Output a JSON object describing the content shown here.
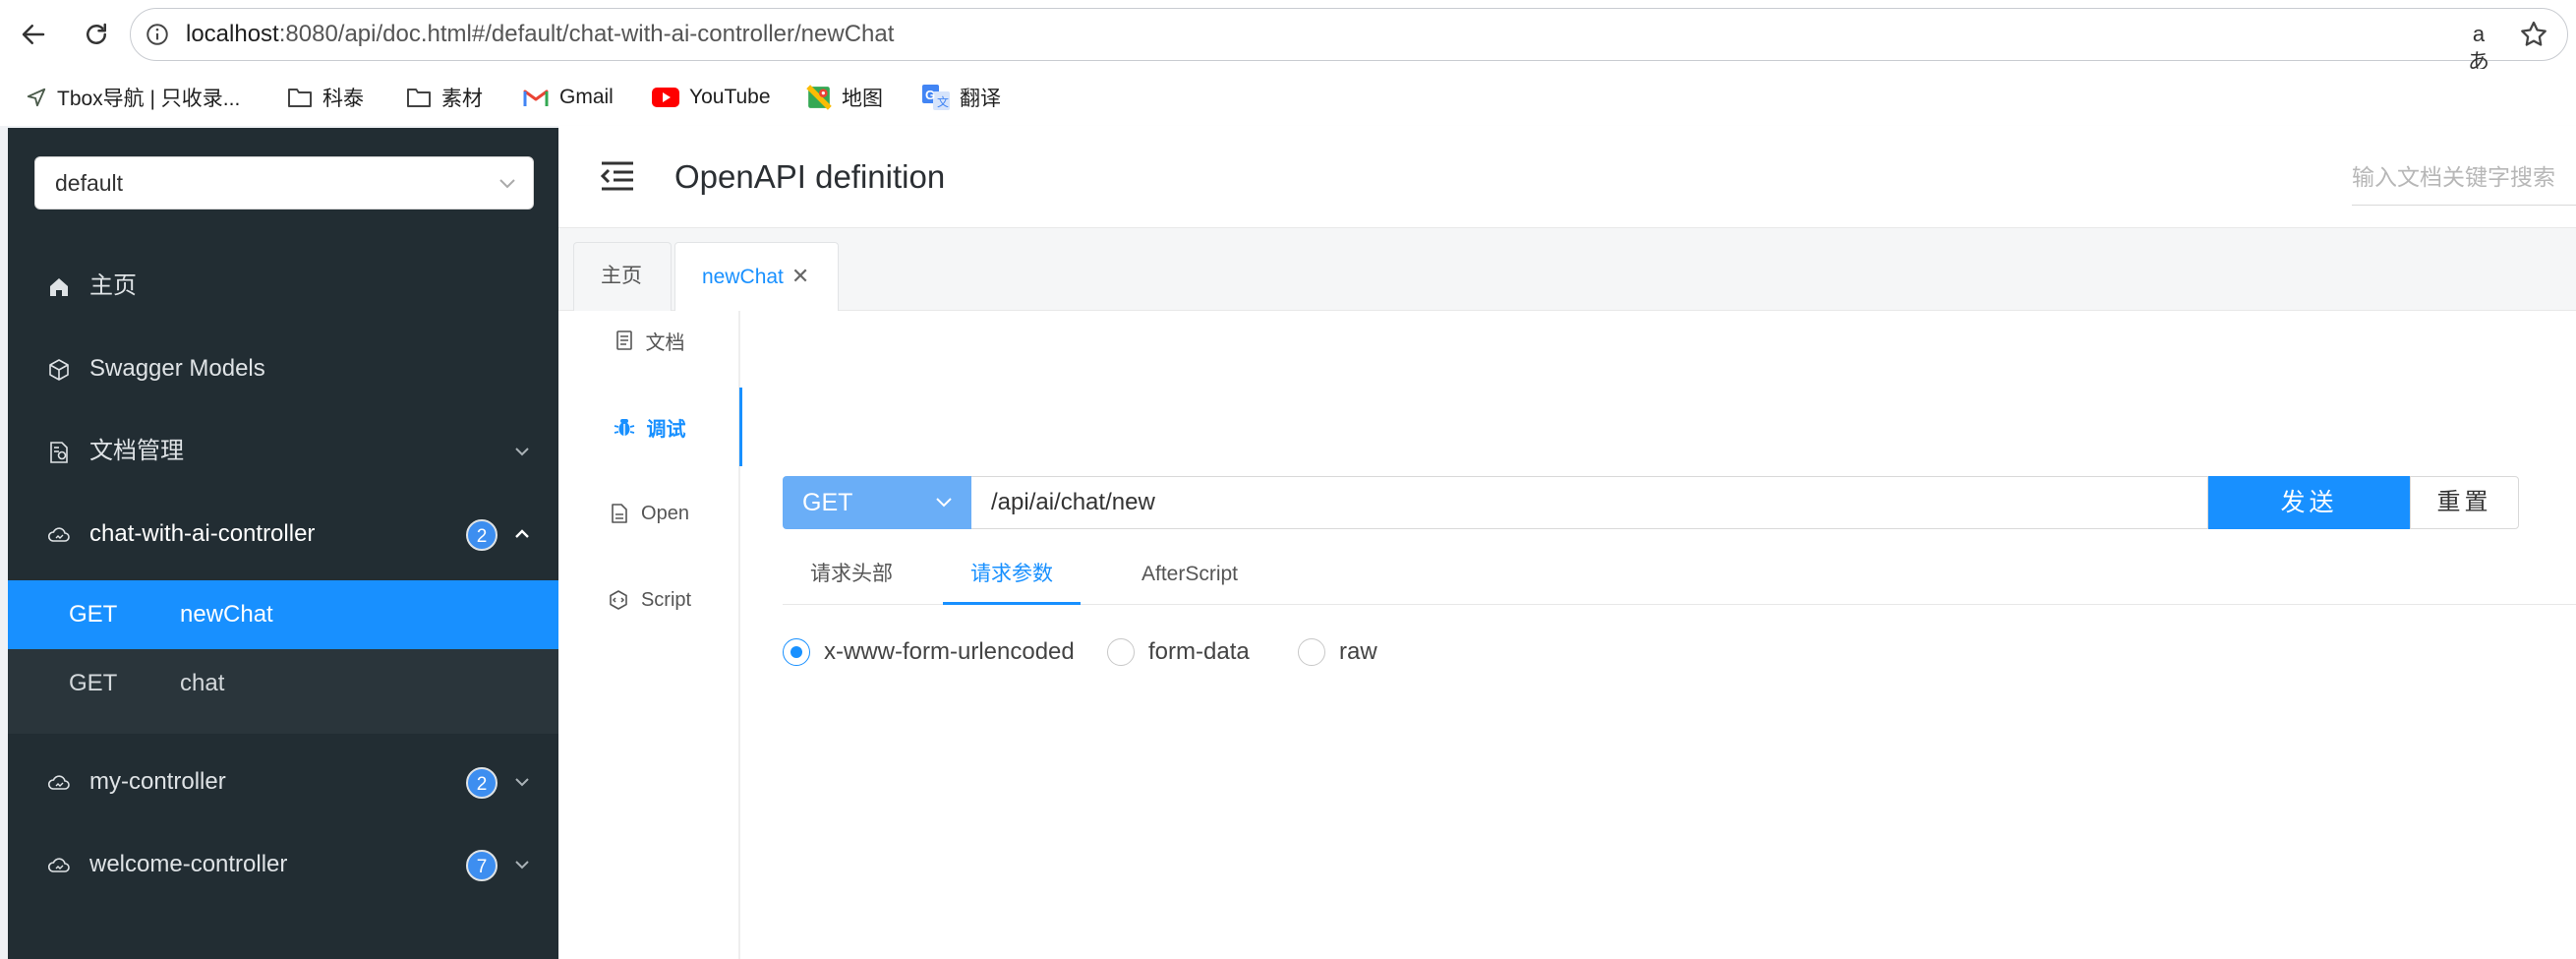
{
  "browser": {
    "url_host": "localhost",
    "url_path": ":8080/api/doc.html#/default/chat-with-ai-controller/newChat",
    "translate_glyph": "aあ",
    "bookmarks": [
      {
        "label": "Tbox导航 | 只收录...",
        "icon": "send-arrow-icon"
      },
      {
        "label": "科泰",
        "icon": "folder-icon"
      },
      {
        "label": "素材",
        "icon": "folder-icon"
      },
      {
        "label": "Gmail",
        "icon": "gmail-icon"
      },
      {
        "label": "YouTube",
        "icon": "youtube-icon"
      },
      {
        "label": "地图",
        "icon": "maps-icon"
      },
      {
        "label": "翻译",
        "icon": "translate-icon"
      }
    ]
  },
  "sidebar": {
    "group_value": "default",
    "menu": [
      {
        "label": "主页",
        "icon": "home-icon"
      },
      {
        "label": "Swagger Models",
        "icon": "cube-icon"
      },
      {
        "label": "文档管理",
        "icon": "doc-manage-icon"
      },
      {
        "label": "chat-with-ai-controller",
        "icon": "cloud-icon",
        "badge": "2"
      },
      {
        "label": "my-controller",
        "icon": "cloud-icon",
        "badge": "2"
      },
      {
        "label": "welcome-controller",
        "icon": "cloud-icon",
        "badge": "7"
      }
    ],
    "sub_items": [
      {
        "method": "GET",
        "name": "newChat",
        "active": true
      },
      {
        "method": "GET",
        "name": "chat",
        "active": false
      }
    ]
  },
  "header": {
    "title": "OpenAPI definition",
    "search_placeholder": "输入文档关键字搜索"
  },
  "tabs": {
    "home": "主页",
    "current": "newChat",
    "close_glyph": "✕"
  },
  "vtabs": [
    {
      "label": "文档",
      "icon": "document-icon"
    },
    {
      "label": "调试",
      "icon": "bug-icon",
      "active": true
    },
    {
      "label": "Open",
      "icon": "file-icon"
    },
    {
      "label": "Script",
      "icon": "code-icon"
    }
  ],
  "request": {
    "method": "GET",
    "url": "/api/ai/chat/new",
    "send_label": "发送",
    "reset_label": "重置"
  },
  "param_tabs": [
    {
      "label": "请求头部"
    },
    {
      "label": "请求参数",
      "active": true
    },
    {
      "label": "AfterScript"
    }
  ],
  "body_types": [
    {
      "label": "x-www-form-urlencoded",
      "checked": true
    },
    {
      "label": "form-data",
      "checked": false
    },
    {
      "label": "raw",
      "checked": false
    }
  ],
  "colors": {
    "sidebar_bg": "#222d33",
    "accent": "#1890ff",
    "method_bg": "#6aaef7",
    "badge": "#3d8ef0"
  }
}
